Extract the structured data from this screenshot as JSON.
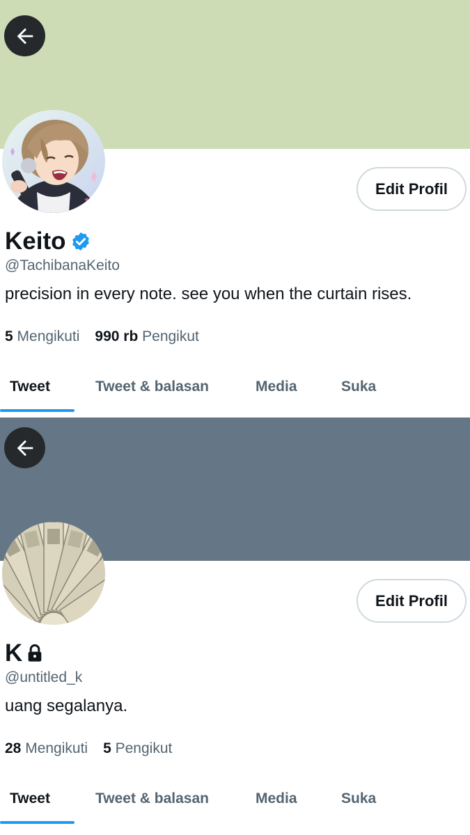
{
  "colors": {
    "banner_1": "#cddcb4",
    "banner_2": "#657786",
    "accent": "#1d9bf0",
    "muted_text": "#536471",
    "primary_text": "#0f1419"
  },
  "profiles": [
    {
      "back_icon": "arrow-left-icon",
      "name": "Keito",
      "badge_icon": "verified-badge-icon",
      "handle": "@TachibanaKeito",
      "bio": "precision in every note. see you when the curtain rises.",
      "edit_label": "Edit Profil",
      "following_count": "5",
      "following_label": "Mengikuti",
      "followers_count": "990 rb",
      "followers_label": "Pengikut",
      "tabs": [
        "Tweet",
        "Tweet & balasan",
        "Media",
        "Suka"
      ],
      "active_tab": "Tweet"
    },
    {
      "back_icon": "arrow-left-icon",
      "name": "K",
      "badge_icon": "lock-icon",
      "handle": "@untitled_k",
      "bio": "uang segalanya.",
      "edit_label": "Edit Profil",
      "following_count": "28",
      "following_label": "Mengikuti",
      "followers_count": "5",
      "followers_label": "Pengikut",
      "tabs": [
        "Tweet",
        "Tweet & balasan",
        "Media",
        "Suka"
      ],
      "active_tab": "Tweet"
    }
  ]
}
